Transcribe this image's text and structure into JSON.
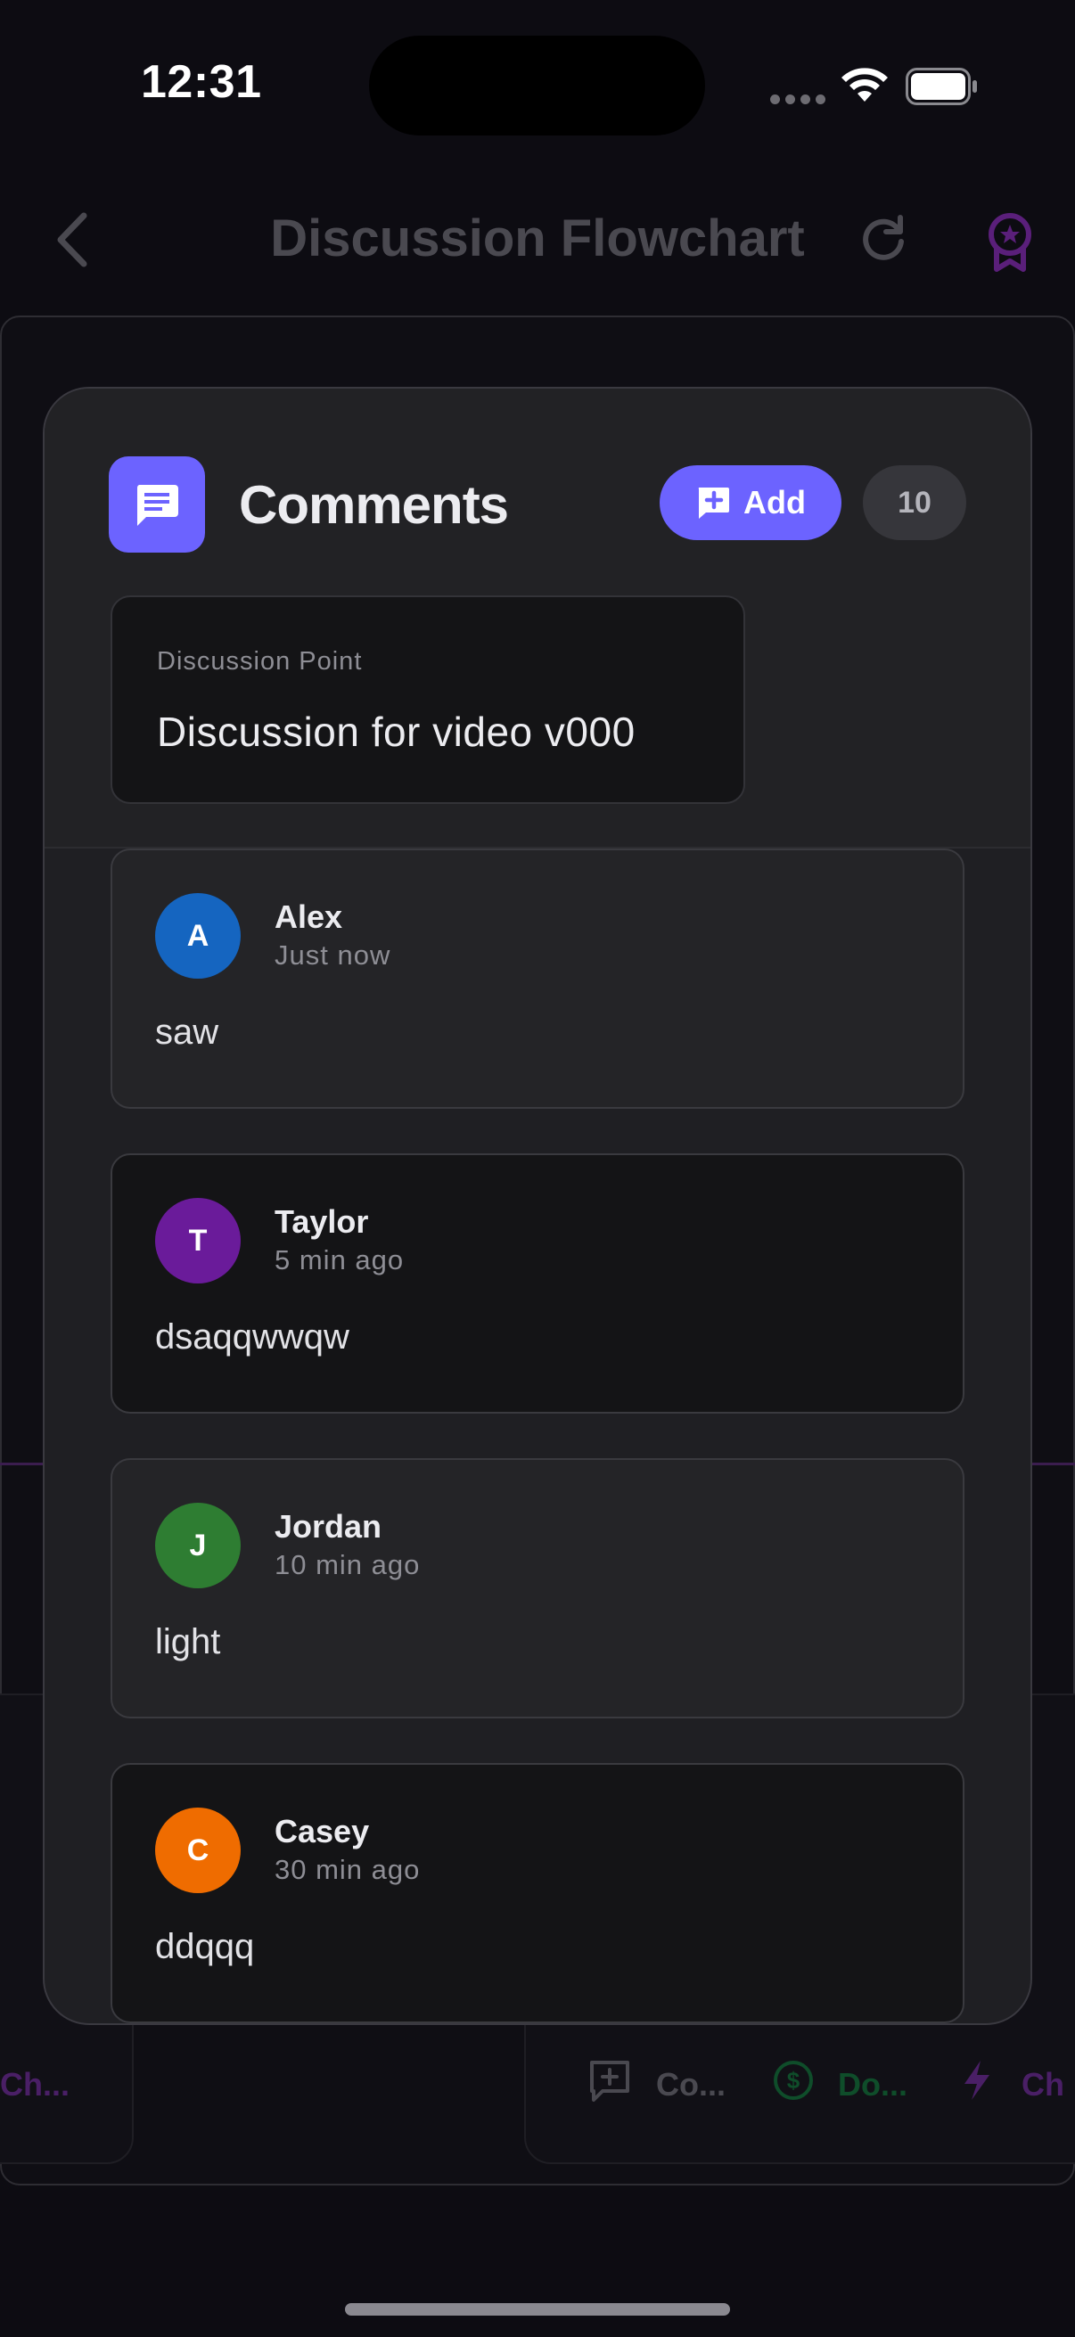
{
  "status_bar": {
    "time": "12:31"
  },
  "nav": {
    "title": "Discussion Flowchart"
  },
  "background_chips": {
    "left_label": "Ch...",
    "comment_label": "Co...",
    "donate_label": "Do...",
    "charge_label": "Ch"
  },
  "modal": {
    "title": "Comments",
    "add_label": "Add",
    "count": "10",
    "discussion_point": {
      "label": "Discussion Point",
      "title": "Discussion for video v000"
    },
    "comments": [
      {
        "initial": "A",
        "name": "Alex",
        "time": "Just now",
        "text": "saw",
        "color": "#1565c0"
      },
      {
        "initial": "T",
        "name": "Taylor",
        "time": "5 min ago",
        "text": "dsaqqwwqw",
        "color": "#6a1b9a"
      },
      {
        "initial": "J",
        "name": "Jordan",
        "time": "10 min ago",
        "text": "light",
        "color": "#2e7d32"
      },
      {
        "initial": "C",
        "name": "Casey",
        "time": "30 min ago",
        "text": "ddqqq",
        "color": "#ef6c00"
      }
    ]
  },
  "colors": {
    "accent": "#6c63ff",
    "background": "#0d0c12",
    "modal": "#1f1f23"
  }
}
